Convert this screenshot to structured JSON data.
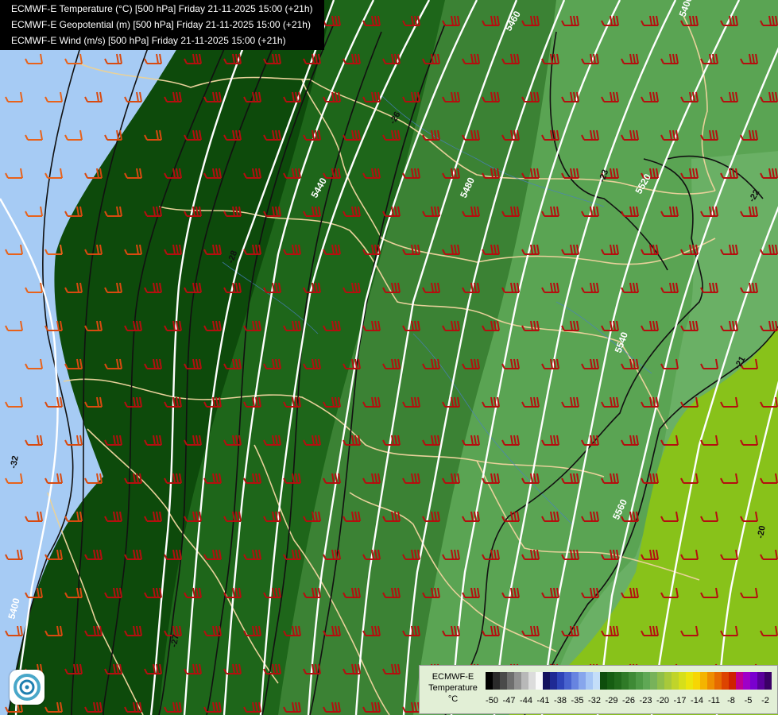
{
  "header": {
    "line1": "ECMWF-E Temperature (°C) [500 hPa] Friday 21-11-2025 15:00 (+21h)",
    "line2": "ECMWF-E Geopotential (m) [500 hPa] Friday 21-11-2025 15:00 (+21h)",
    "line3": "ECMWF-E Wind (m/s) [500 hPa] Friday 21-11-2025 15:00 (+21h)"
  },
  "legend": {
    "title": [
      "ECMWF-E",
      "Temperature",
      "°C"
    ],
    "ticks": [
      "-50",
      "-47",
      "-44",
      "-41",
      "-38",
      "-35",
      "-32",
      "-29",
      "-26",
      "-23",
      "-20",
      "-17",
      "-14",
      "-11",
      "-8",
      "-5",
      "-2"
    ],
    "colors": [
      "#000000",
      "#2a2a2a",
      "#4a4a4a",
      "#6e6e6e",
      "#929292",
      "#b8b8b8",
      "#dcdcdc",
      "#fafafa",
      "#15135e",
      "#1f2a94",
      "#2e44b8",
      "#4863cf",
      "#6784e0",
      "#87a6ec",
      "#a6c6f5",
      "#c4def9",
      "#0e4d0c",
      "#165d12",
      "#216a1b",
      "#2f7a27",
      "#3e8a35",
      "#4e9a45",
      "#5fa855",
      "#78b25a",
      "#8fbe4a",
      "#a8c93a",
      "#c0d42a",
      "#d6df1a",
      "#ece50c",
      "#f7d604",
      "#f4b400",
      "#ee8e00",
      "#e66a00",
      "#dd4400",
      "#cf2200",
      "#c00090",
      "#9f00c8",
      "#7a00cf",
      "#5a009a",
      "#3b0066"
    ]
  },
  "map": {
    "geopotential_labels": [
      "5400",
      "5440",
      "5460",
      "5480",
      "5520",
      "5540",
      "5560",
      "5400"
    ],
    "temperature_labels": [
      "-32",
      "-28",
      "-27",
      "-26",
      "-23",
      "-22",
      "-21",
      "-20"
    ],
    "temperature_fill_colors": {
      "cold": "#a9ccf2",
      "mid": "#0f520c",
      "mild": "#5ea655",
      "warm": "#86c21a"
    }
  },
  "logo": {
    "icon": "weather-model-logo-icon"
  }
}
